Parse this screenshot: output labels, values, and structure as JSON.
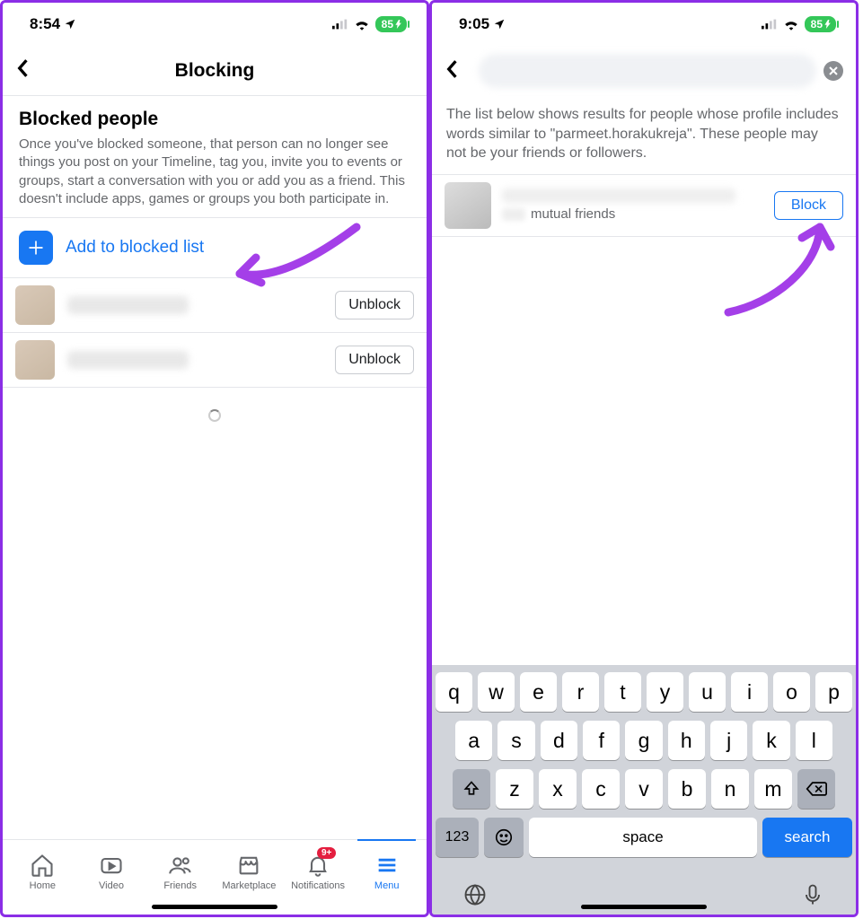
{
  "left": {
    "status": {
      "time": "8:54",
      "battery": "85"
    },
    "header": {
      "title": "Blocking"
    },
    "section": {
      "title": "Blocked people",
      "description": "Once you've blocked someone, that person can no longer see things you post on your Timeline, tag you, invite you to events or groups, start a conversation with you or add you as a friend. This doesn't include apps, games or groups you both participate in."
    },
    "add_label": "Add to blocked list",
    "unblock_label": "Unblock",
    "tabs": {
      "home": "Home",
      "video": "Video",
      "friends": "Friends",
      "marketplace": "Marketplace",
      "notifications": "Notifications",
      "menu": "Menu",
      "badge": "9+"
    }
  },
  "right": {
    "status": {
      "time": "9:05",
      "battery": "85"
    },
    "search_description": "The list below shows results for people whose profile includes words similar to \"parmeet.horakukreja\". These people may not be your friends or followers.",
    "mutual_label": "mutual friends",
    "block_label": "Block",
    "keyboard": {
      "row1": [
        "q",
        "w",
        "e",
        "r",
        "t",
        "y",
        "u",
        "i",
        "o",
        "p"
      ],
      "row2": [
        "a",
        "s",
        "d",
        "f",
        "g",
        "h",
        "j",
        "k",
        "l"
      ],
      "row3": [
        "z",
        "x",
        "c",
        "v",
        "b",
        "n",
        "m"
      ],
      "num": "123",
      "space": "space",
      "search": "search"
    }
  }
}
